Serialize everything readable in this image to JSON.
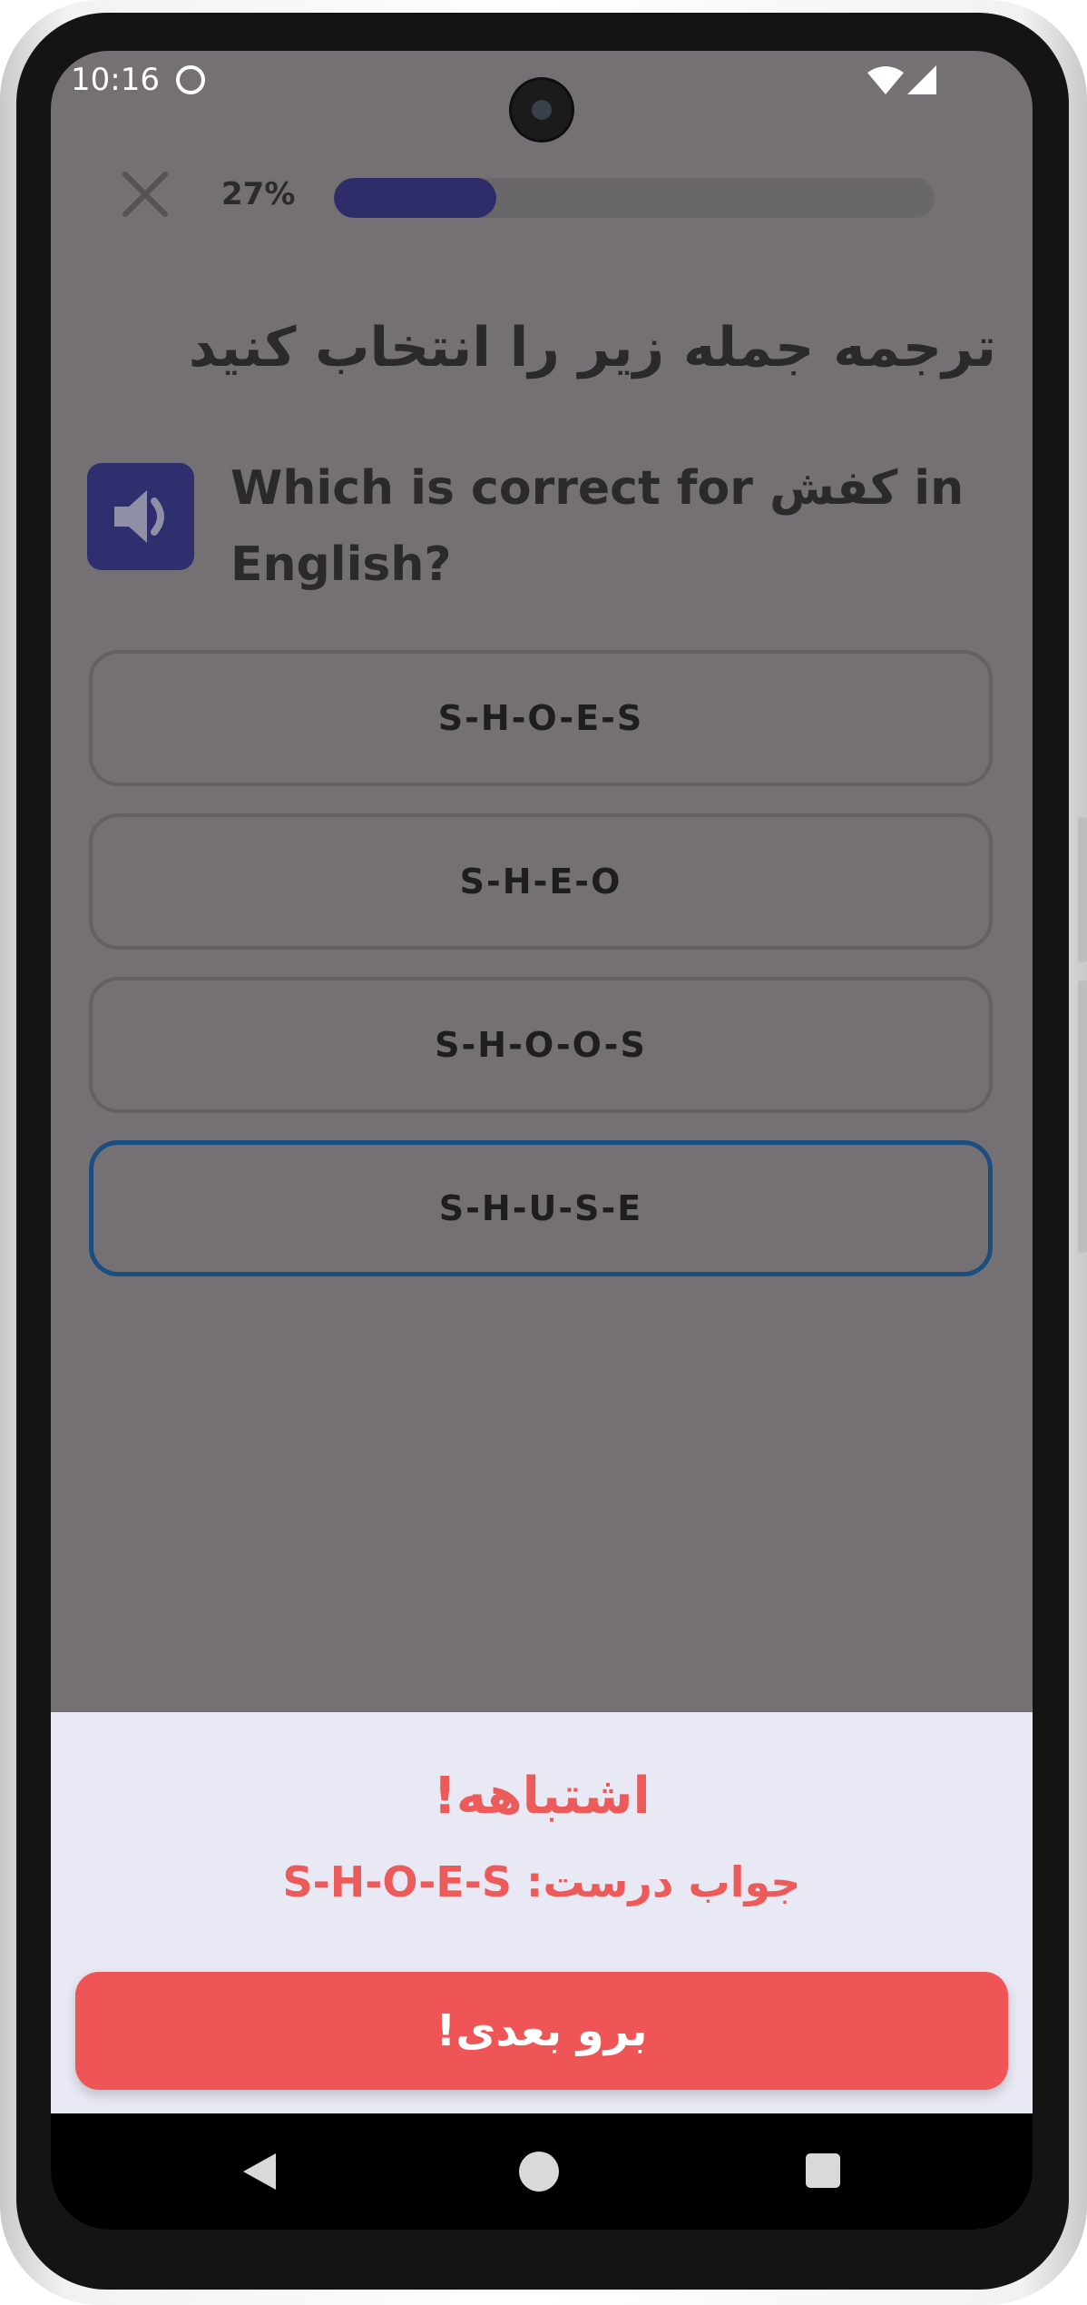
{
  "status_bar": {
    "time": "10:16",
    "icons": [
      "app-notification-icon",
      "wifi-icon",
      "signal-icon"
    ]
  },
  "lesson": {
    "progress_label": "27%",
    "progress_value": 0.27
  },
  "exercise": {
    "title": "ترجمه جمله زیر را انتخاب کنید",
    "question": "Which is correct for کفش in English?",
    "options": [
      {
        "label": "S-H-O-E-S",
        "selected": false
      },
      {
        "label": "S-H-E-O",
        "selected": false
      },
      {
        "label": "S-H-O-O-S",
        "selected": false
      },
      {
        "label": "S-H-U-S-E",
        "selected": true
      }
    ]
  },
  "feedback": {
    "title": "اشتباهه!",
    "answer": "جواب درست: S-H-O-E-S",
    "next_label": "برو بعدی!"
  },
  "colors": {
    "progress_fill": "#2f2d69",
    "accent_red": "#ef5456",
    "selected_border": "#1b4d80",
    "feedback_bg": "#e8e9f4"
  }
}
